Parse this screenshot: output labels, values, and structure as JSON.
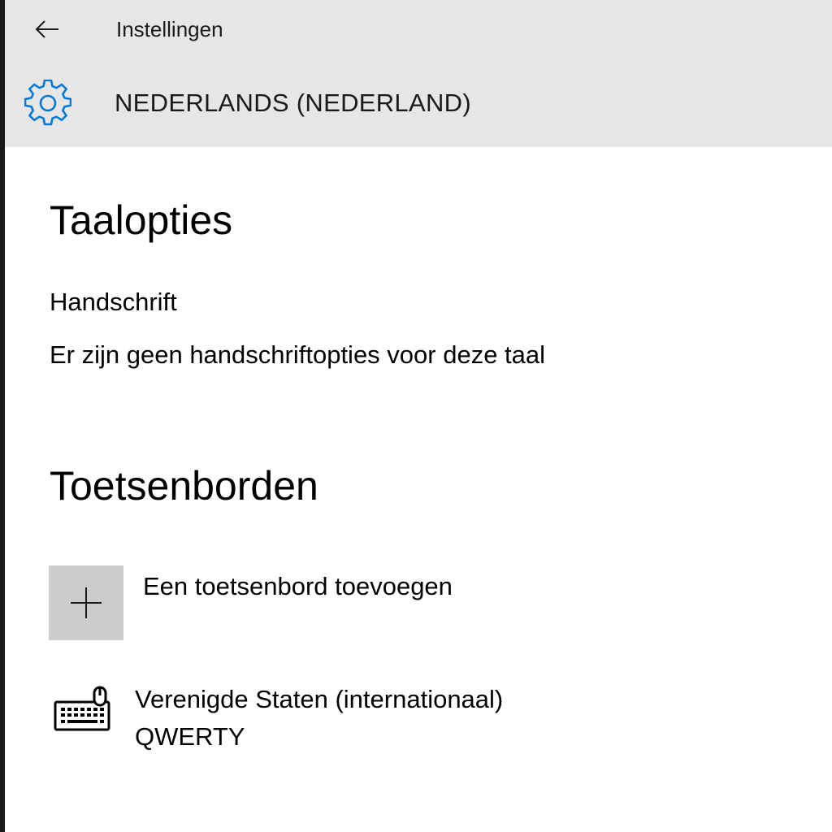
{
  "window": {
    "title": "Instellingen",
    "back_icon": "arrow-left-icon"
  },
  "header": {
    "icon": "gear-icon",
    "title": "NEDERLANDS (NEDERLAND)",
    "accent_color": "#0078d7"
  },
  "language_options": {
    "heading": "Taalopties",
    "handwriting": {
      "label": "Handschrift",
      "status": "Er zijn geen handschriftopties voor deze taal"
    }
  },
  "keyboards": {
    "heading": "Toetsenborden",
    "add_button": {
      "icon": "plus-icon",
      "label": "Een toetsenbord toevoegen"
    },
    "items": [
      {
        "icon": "keyboard-icon",
        "name": "Verenigde Staten (internationaal)",
        "layout": "QWERTY"
      }
    ]
  }
}
